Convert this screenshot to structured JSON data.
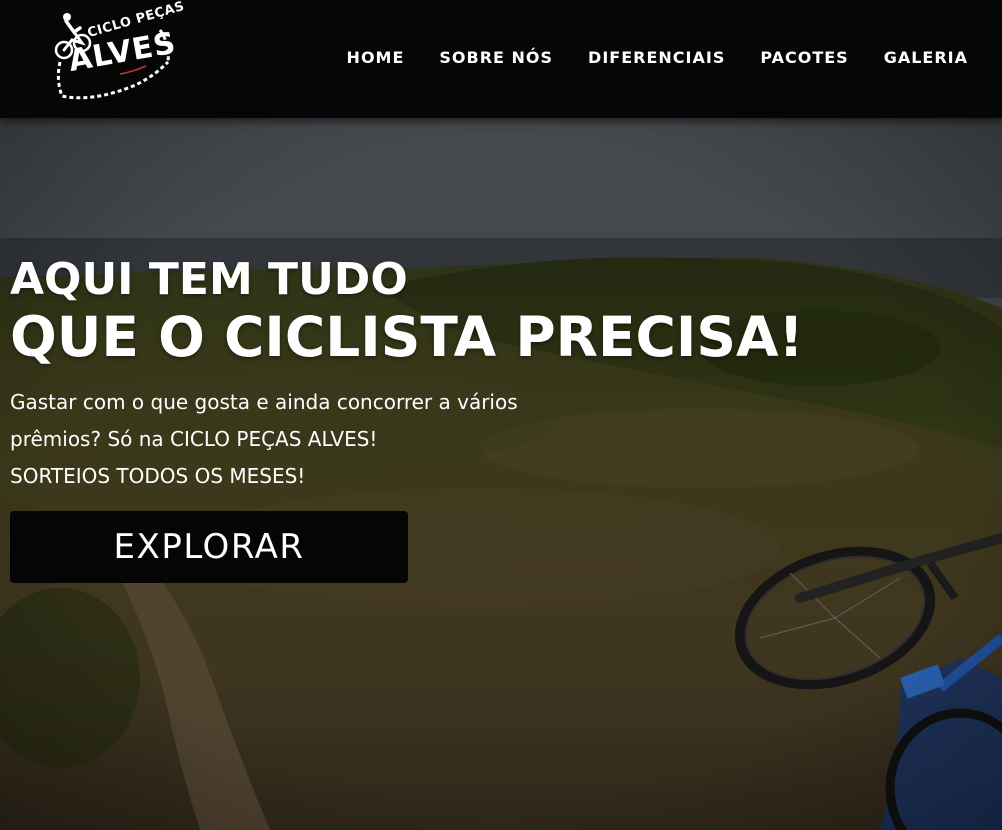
{
  "header": {
    "logo": {
      "line1": "CICLO PEÇAS",
      "line2": "ALVES"
    },
    "nav": [
      {
        "label": "HOME"
      },
      {
        "label": "SOBRE NÓS"
      },
      {
        "label": "DIFERENCIAIS"
      },
      {
        "label": "PACOTES"
      },
      {
        "label": "GALERIA"
      }
    ]
  },
  "hero": {
    "title_line1": "AQUI TEM TUDO",
    "title_line2": "QUE O CICLISTA PRECISA!",
    "description": [
      "Gastar com o que gosta e ainda concorrer a vários",
      "prêmios? Só na CICLO PEÇAS ALVES!",
      "SORTEIOS TODOS OS MESES!"
    ],
    "cta_label": "EXPLORAR"
  },
  "colors": {
    "header_bg": "#060606",
    "text": "#ffffff",
    "button_bg": "#050505",
    "logo_accent": "#c0392b"
  }
}
